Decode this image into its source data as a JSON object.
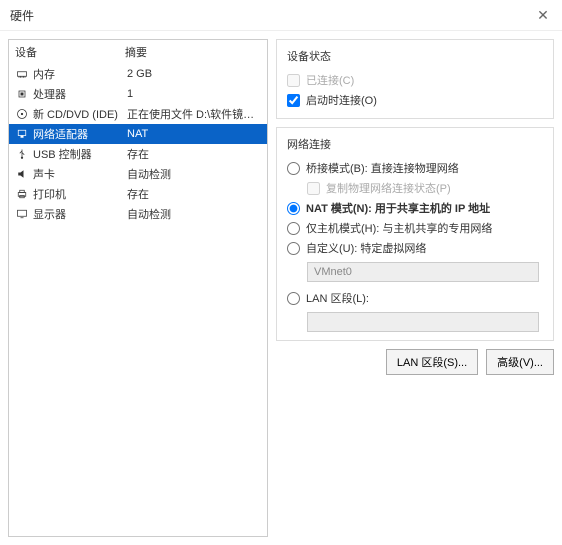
{
  "window": {
    "title": "硬件"
  },
  "device_header": {
    "col1": "设备",
    "col2": "摘要"
  },
  "devices": [
    {
      "icon": "memory-icon",
      "name": "内存",
      "summary": "2 GB"
    },
    {
      "icon": "cpu-icon",
      "name": "处理器",
      "summary": "1"
    },
    {
      "icon": "cd-icon",
      "name": "新 CD/DVD (IDE)",
      "summary": "正在使用文件 D:\\软件镜像\\..."
    },
    {
      "icon": "network-icon",
      "name": "网络适配器",
      "summary": "NAT",
      "selected": true
    },
    {
      "icon": "usb-icon",
      "name": "USB 控制器",
      "summary": "存在"
    },
    {
      "icon": "sound-icon",
      "name": "声卡",
      "summary": "自动检测"
    },
    {
      "icon": "printer-icon",
      "name": "打印机",
      "summary": "存在"
    },
    {
      "icon": "display-icon",
      "name": "显示器",
      "summary": "自动检测"
    }
  ],
  "status": {
    "title": "设备状态",
    "connected": "已连接(C)",
    "connect_at_power": "启动时连接(O)"
  },
  "network": {
    "title": "网络连接",
    "bridged": "桥接模式(B): 直接连接物理网络",
    "bridged_sub": "复制物理网络连接状态(P)",
    "nat": "NAT 模式(N): 用于共享主机的 IP 地址",
    "hostonly": "仅主机模式(H): 与主机共享的专用网络",
    "custom": "自定义(U): 特定虚拟网络",
    "custom_value": "VMnet0",
    "lan": "LAN 区段(L):"
  },
  "buttons": {
    "lan_segments": "LAN 区段(S)...",
    "advanced": "高级(V)..."
  }
}
